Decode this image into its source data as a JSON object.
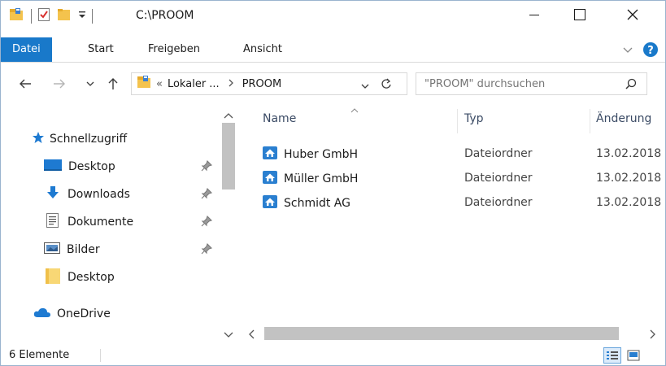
{
  "window": {
    "title": "C:\\PROOM",
    "minimize_icon": "minimize-icon",
    "maximize_icon": "maximize-icon",
    "close_icon": "close-icon"
  },
  "ribbon": {
    "tabs": [
      {
        "label": "Datei",
        "active": true
      },
      {
        "label": "Start",
        "active": false
      },
      {
        "label": "Freigeben",
        "active": false
      },
      {
        "label": "Ansicht",
        "active": false
      }
    ],
    "accent_color": "#1979ca"
  },
  "navigation": {
    "breadcrumb_prefix": "«",
    "breadcrumb": [
      "Lokaler ...",
      "PROOM"
    ],
    "search_placeholder": "\"PROOM\" durchsuchen"
  },
  "nav_pane": {
    "items": [
      {
        "label": "Schnellzugriff",
        "icon": "star-icon",
        "pinned": false
      },
      {
        "label": "Desktop",
        "icon": "desktop-icon",
        "pinned": true
      },
      {
        "label": "Downloads",
        "icon": "download-icon",
        "pinned": true
      },
      {
        "label": "Dokumente",
        "icon": "document-icon",
        "pinned": true
      },
      {
        "label": "Bilder",
        "icon": "pictures-icon",
        "pinned": true
      },
      {
        "label": "Desktop",
        "icon": "folder-icon",
        "pinned": false
      },
      {
        "label": "OneDrive",
        "icon": "cloud-icon",
        "pinned": false
      }
    ]
  },
  "file_list": {
    "columns": [
      "Name",
      "Typ",
      "Änderung"
    ],
    "rows": [
      {
        "name": "Huber GmbH",
        "type": "Dateiordner",
        "date": "13.02.2018"
      },
      {
        "name": "Müller GmbH",
        "type": "Dateiordner",
        "date": "13.02.2018"
      },
      {
        "name": "Schmidt AG",
        "type": "Dateiordner",
        "date": "13.02.2018"
      }
    ]
  },
  "status_bar": {
    "count": "6 Elemente"
  }
}
